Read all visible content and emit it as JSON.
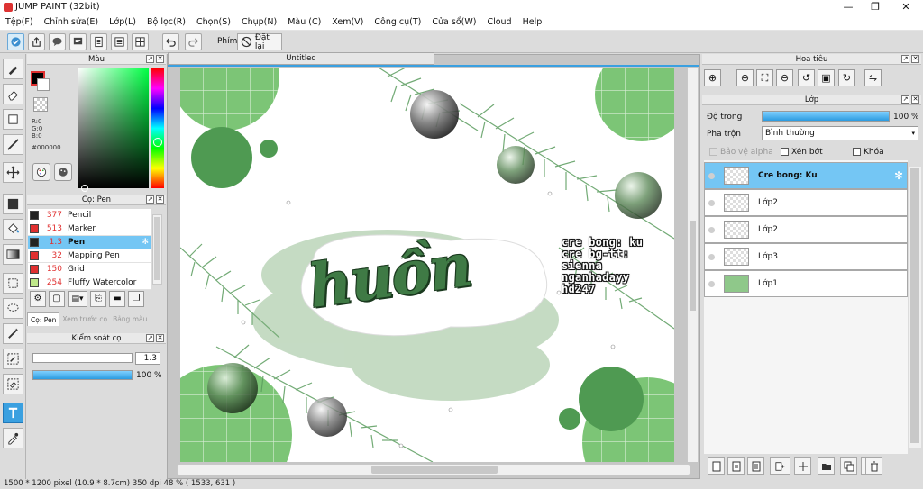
{
  "window": {
    "title": "JUMP PAINT (32bit)",
    "minimize": "—",
    "maximize": "❐",
    "close": "✕"
  },
  "menu": [
    "Tệp(F)",
    "Chỉnh sửa(E)",
    "Lớp(L)",
    "Bộ lọc(R)",
    "Chọn(S)",
    "Chụp(N)",
    "Màu (C)",
    "Xem(V)",
    "Công cụ(T)",
    "Cửa sổ(W)",
    "Cloud",
    "Help"
  ],
  "toolbar": {
    "key_label": "Phím",
    "reset_label": "Đặt lại"
  },
  "color_panel": {
    "title": "Màu",
    "r": "R:0",
    "g": "G:0",
    "b": "B:0",
    "hex": "#000000"
  },
  "brush_panel": {
    "title": "Cọ: Pen",
    "brushes": [
      {
        "size": "377",
        "name": "Pencil",
        "color": "#222222"
      },
      {
        "size": "513",
        "name": "Marker",
        "color": "#e03030"
      },
      {
        "size": "1.3",
        "name": "Pen",
        "color": "#222222",
        "selected": true
      },
      {
        "size": "32",
        "name": "Mapping Pen",
        "color": "#e03030"
      },
      {
        "size": "150",
        "name": "Grid",
        "color": "#e03030"
      },
      {
        "size": "254",
        "name": "Fluffy Watercolor",
        "color": "#bfe88a"
      }
    ],
    "tabs": [
      "Cọ: Pen",
      "Xem trước cọ",
      "Bảng màu"
    ]
  },
  "brush_control": {
    "title": "Kiểm soát cọ",
    "size": "1.3",
    "opacity": "100 %",
    "opacity_value": 100
  },
  "canvas": {
    "tab_title": "Untitled",
    "title_text": "huồn",
    "credits": [
      "cre bong: ku",
      "cre bg-tt: sienna",
      "nganhadayy",
      "hd247"
    ]
  },
  "navigator": {
    "title": "Hoa tiêu"
  },
  "layers_panel": {
    "title": "Lớp",
    "opacity_label": "Độ trong",
    "opacity_value": "100 %",
    "opacity_level": 100,
    "blend_label": "Pha trộn",
    "blend_value": "Bình thường",
    "protect_alpha": "Bảo vệ alpha",
    "clipping": "Xén bớt",
    "lock": "Khóa",
    "layers": [
      {
        "name": "Cre bong: Ku",
        "selected": true
      },
      {
        "name": "Lớp2"
      },
      {
        "name": "Lớp2"
      },
      {
        "name": "Lớp3"
      },
      {
        "name": "Lớp1"
      }
    ]
  },
  "status": {
    "text": "1500 * 1200 pixel   (10.9 * 8.7cm)   350 dpi   48 %   ( 1533, 631 )"
  },
  "colors": {
    "accent": "#3aa0e0",
    "selection": "#74c6f4",
    "green": "#7cc576"
  }
}
